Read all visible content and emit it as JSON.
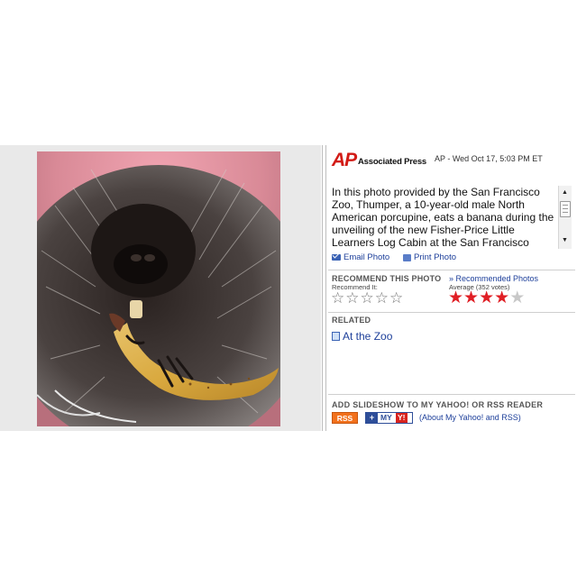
{
  "photo": {
    "subject": "porcupine eating a banana"
  },
  "header": {
    "logo_text": "AP",
    "agency_name": "Associated Press",
    "date_line": "AP - Wed Oct 17, 5:03 PM ET"
  },
  "caption": {
    "text": "In this photo provided by the San Francisco Zoo, Thumper, a 10-year-old male North American porcupine, eats a banana during the unveiling of the new Fisher-Price Little Learners Log Cabin at the San Francisco"
  },
  "scrollbar": {
    "up_arrow": "▲",
    "down_arrow": "▼"
  },
  "actions": {
    "email_label": "Email Photo",
    "print_label": "Print Photo"
  },
  "recommend": {
    "title": "RECOMMEND THIS PHOTO",
    "recommended_link": "» Recommended Photos",
    "recommend_it_label": "Recommend It:",
    "average_label": "Average (352 votes)",
    "average_rating": 4,
    "max_rating": 5,
    "star_glyph_empty": "☆",
    "star_glyph_full": "★"
  },
  "related": {
    "title": "RELATED",
    "link_label": "At the Zoo"
  },
  "slideshow": {
    "title": "ADD SLIDESHOW TO MY YAHOO! OR RSS READER",
    "rss_label": "RSS",
    "my_yahoo_plus": "+",
    "my_yahoo_label": "MY",
    "my_yahoo_y": "Y!",
    "about_link": "(About My Yahoo! and RSS)"
  },
  "colors": {
    "ap_red": "#d21b16",
    "link_blue": "#1d3f9a",
    "star_red": "#e01f25",
    "rss_orange": "#f2711c"
  }
}
